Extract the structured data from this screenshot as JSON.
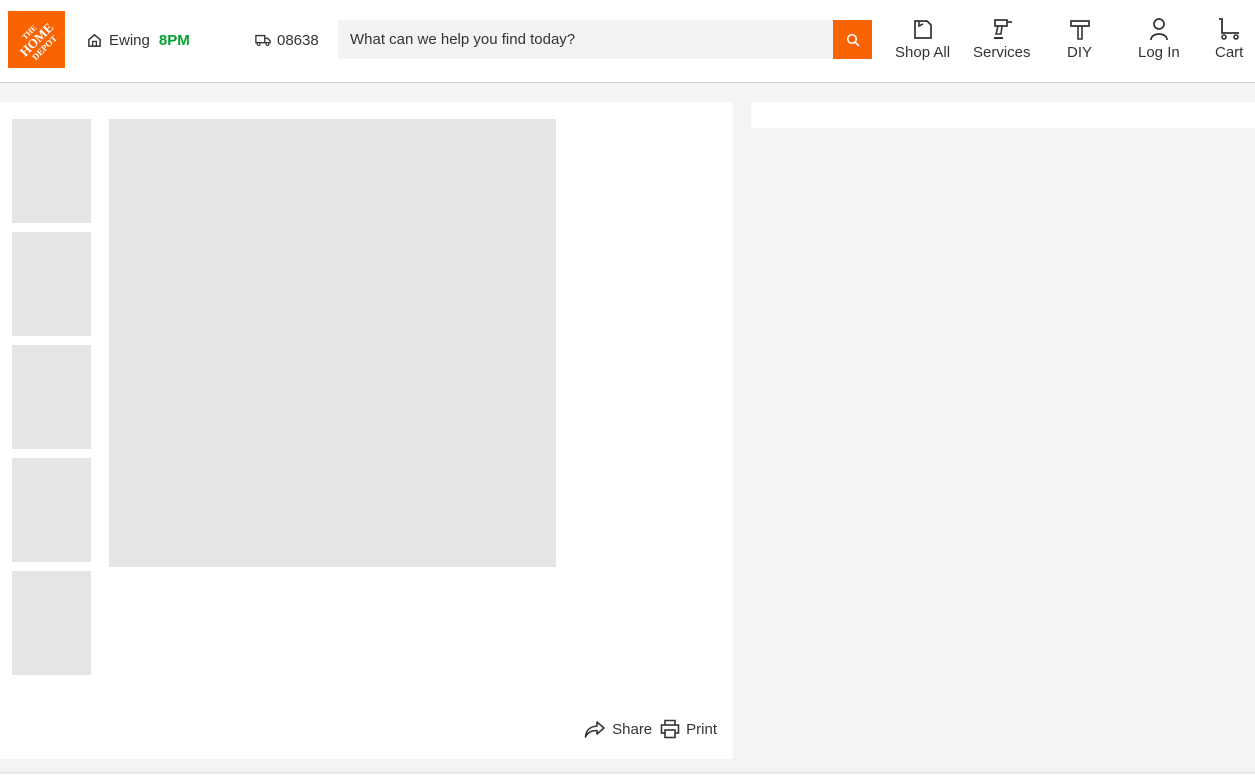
{
  "header": {
    "logo_text": "THE HOME DEPOT",
    "store": {
      "name": "Ewing",
      "hours": "8PM"
    },
    "delivery_zip": "08638",
    "search": {
      "placeholder": "What can we help you find today?"
    },
    "nav": [
      {
        "label": "Shop All",
        "icon": "shop-all-icon"
      },
      {
        "label": "Services",
        "icon": "drill-icon"
      },
      {
        "label": "DIY",
        "icon": "hammer-icon"
      },
      {
        "label": "Log In",
        "icon": "user-icon"
      },
      {
        "label": "Cart",
        "icon": "cart-icon"
      }
    ]
  },
  "product": {
    "share_label": "Share",
    "print_label": "Print"
  },
  "colors": {
    "brand": "#f96302",
    "open_hours": "#00a330",
    "placeholder": "#e5e5e5"
  }
}
